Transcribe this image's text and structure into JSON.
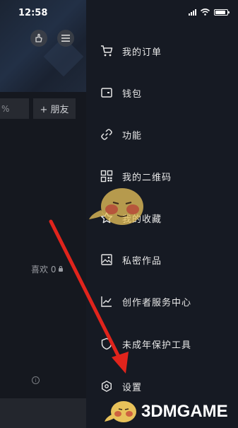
{
  "status_bar": {
    "time": "12:58"
  },
  "profile": {
    "percent_text": "%",
    "add_friend_label": "+ 朋友",
    "likes_label": "喜欢 0",
    "info_glyph": "i"
  },
  "drawer": {
    "items": [
      {
        "label": "我的订单",
        "icon": "cart-icon"
      },
      {
        "label": "钱包",
        "icon": "wallet-icon"
      },
      {
        "label": "功能",
        "icon": "link-icon"
      },
      {
        "label": "我的二维码",
        "icon": "qrcode-icon"
      },
      {
        "label": "我的收藏",
        "icon": "star-icon"
      },
      {
        "label": "私密作品",
        "icon": "private-image-icon"
      },
      {
        "label": "创作者服务中心",
        "icon": "chart-icon"
      },
      {
        "label": "未成年保护工具",
        "icon": "shield-icon"
      },
      {
        "label": "设置",
        "icon": "settings-hexagon-icon"
      }
    ]
  },
  "watermark": {
    "text": "3DMGAME"
  },
  "colors": {
    "background": "#141821",
    "drawer_bg": "#161a23",
    "text": "#e8e8e8",
    "arrow": "#e0241c",
    "mascot": "#e8c25a"
  }
}
